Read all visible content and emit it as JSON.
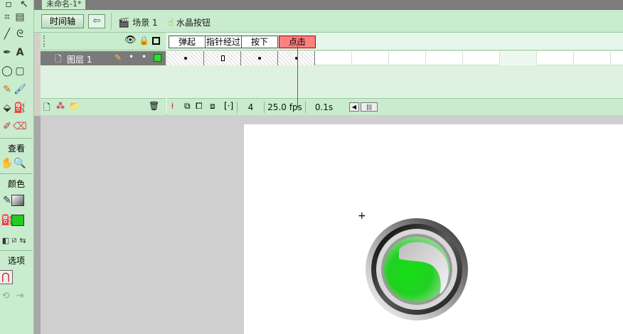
{
  "document": {
    "tab_title": "未命名-1*"
  },
  "editbar": {
    "timeline_button": "时间轴",
    "back_icon": "back-arrow-icon",
    "scene_label": "场景 1",
    "symbol_label": "水晶按钮"
  },
  "tools": {
    "view_label": "查看",
    "color_label": "颜色",
    "options_label": "选项",
    "stroke_color": "#555555",
    "fill_color": "#22cc22"
  },
  "timeline": {
    "frame_labels": [
      "弹起",
      "指针经过",
      "按下",
      "点击"
    ],
    "active_frame_label": "点击",
    "layer_name": "图层 1",
    "current_frame": "4",
    "fps": "25.0 fps",
    "elapsed": "0.1s",
    "layer_color": "#33dd33"
  },
  "stage": {
    "background": "#ffffff",
    "button_fill": "#22dd22",
    "button_ring": "#111111"
  }
}
